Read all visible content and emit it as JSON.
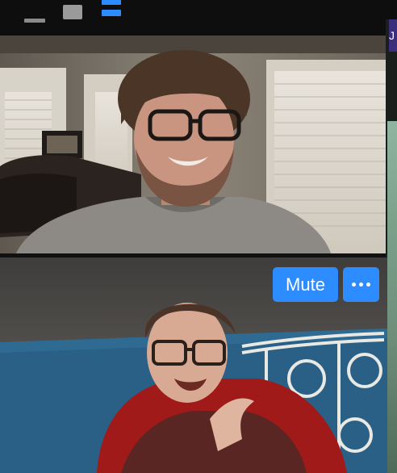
{
  "toolbar": {
    "minimize_icon": "minimize-icon",
    "maximize_icon": "maximize-icon",
    "gallery_view_icon": "grid-view-icon"
  },
  "side_panel": {
    "tab_initial": "J"
  },
  "participants": [
    {
      "tile": "video-tile-1",
      "active_speaker": false
    },
    {
      "tile": "video-tile-2",
      "active_speaker": true
    }
  ],
  "tile_controls": {
    "mute_label": "Mute",
    "more_icon": "ellipsis-icon"
  },
  "colors": {
    "accent": "#2d8cff",
    "active_speaker_border": "#d6e05a",
    "background": "#0e0e0e"
  }
}
